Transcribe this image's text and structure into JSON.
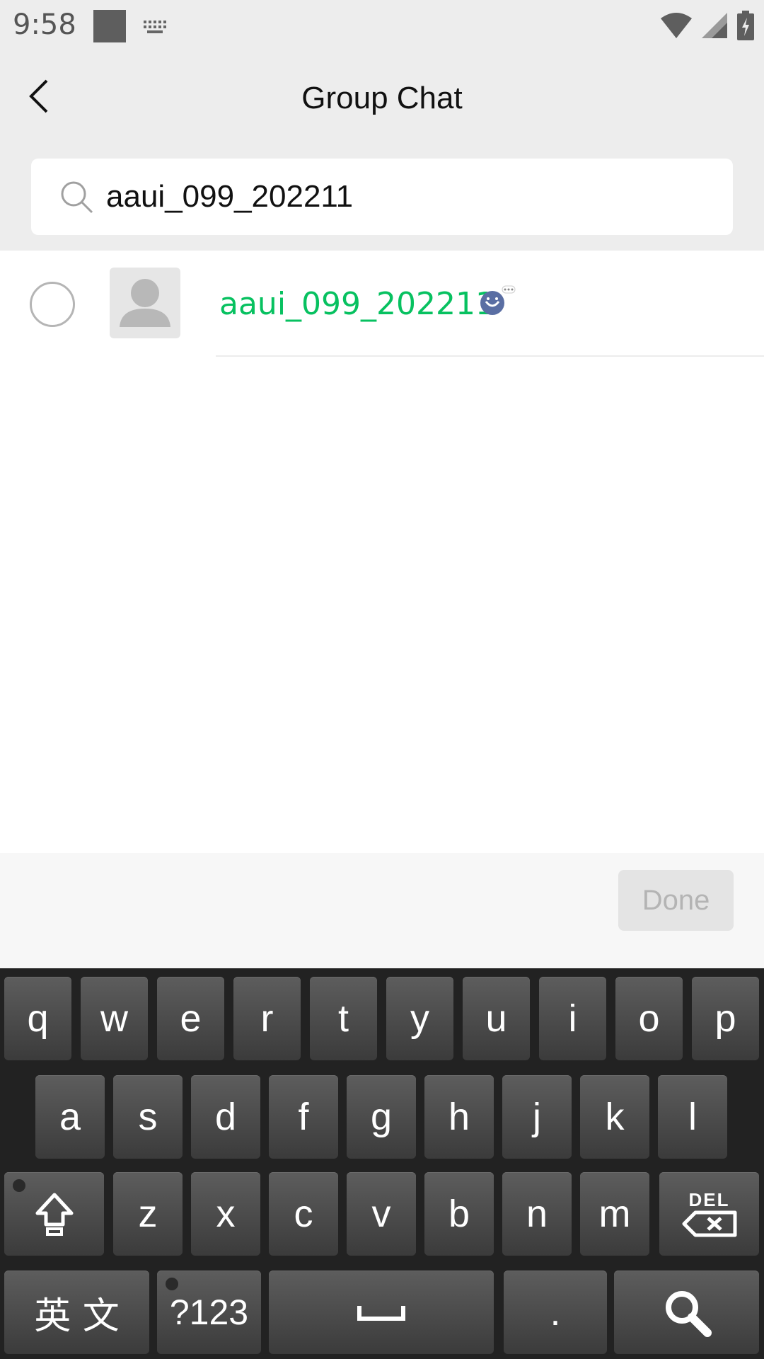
{
  "status_bar": {
    "time": "9:58"
  },
  "header": {
    "title": "Group Chat"
  },
  "search": {
    "value": "aaui_099_202211"
  },
  "results": [
    {
      "name": "aaui_099_202211"
    }
  ],
  "action_bar": {
    "done_label": "Done"
  },
  "keyboard": {
    "row1": [
      "q",
      "w",
      "e",
      "r",
      "t",
      "y",
      "u",
      "i",
      "o",
      "p"
    ],
    "row2": [
      "a",
      "s",
      "d",
      "f",
      "g",
      "h",
      "j",
      "k",
      "l"
    ],
    "row3": [
      "z",
      "x",
      "c",
      "v",
      "b",
      "n",
      "m"
    ],
    "del_label": "DEL",
    "lang_label": "英 文",
    "sym_label": "?123",
    "period_label": "."
  },
  "colors": {
    "accent_green": "#07c160",
    "header_bg": "#ededed",
    "keyboard_bg": "#222222"
  },
  "icons": [
    "back-arrow-icon",
    "search-icon",
    "default-avatar-icon",
    "emoji-badge-icon",
    "shift-icon",
    "delete-icon",
    "space-icon",
    "keyboard-search-icon",
    "wifi-icon",
    "signal-icon",
    "battery-icon"
  ]
}
